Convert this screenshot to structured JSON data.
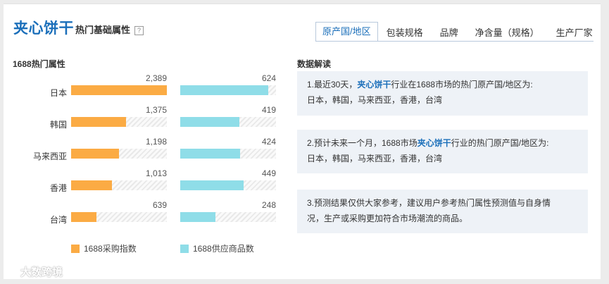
{
  "header": {
    "title_main": "夹心饼干",
    "title_sub": "热门基础属性",
    "help": "?"
  },
  "tabs": [
    {
      "label": "原产国/地区",
      "active": true
    },
    {
      "label": "包装规格",
      "active": false
    },
    {
      "label": "品牌",
      "active": false
    },
    {
      "label": "净含量（规格）",
      "active": false
    },
    {
      "label": "生产厂家",
      "active": false
    }
  ],
  "left": {
    "title": "1688热门属性"
  },
  "chart_data": {
    "type": "bar",
    "categories": [
      "日本",
      "韩国",
      "马来西亚",
      "香港",
      "台湾"
    ],
    "series": [
      {
        "name": "1688采购指数",
        "values": [
          2389,
          1375,
          1198,
          1013,
          639
        ],
        "labels": [
          "2,389",
          "1,375",
          "1,198",
          "1,013",
          "639"
        ],
        "color": "#fbab44"
      },
      {
        "name": "1688供应商品数",
        "values": [
          624,
          419,
          424,
          449,
          248
        ],
        "labels": [
          "624",
          "419",
          "424",
          "449",
          "248"
        ],
        "color": "#8fdde8"
      }
    ]
  },
  "right": {
    "title": "数据解读",
    "cards": [
      {
        "prefix": "1.最近30天，",
        "keyword": "夹心饼干",
        "suffix": "行业在1688市场的热门原产国/地区为:",
        "line2": "日本，韩国，马来西亚，香港，台湾"
      },
      {
        "prefix": "2.预计未来一个月，1688市场",
        "keyword": "夹心饼干",
        "suffix": "行业的热门原产国/地区为:",
        "line2": "日本，韩国，马来西亚，香港，台湾"
      },
      {
        "prefix": "3.预测结果仅供大家参考，建议用户参考热门属性预测值与自身情",
        "keyword": "",
        "suffix": "",
        "line2": "况，生产或采购更加符合市场潮流的商品。"
      }
    ]
  },
  "watermark": {
    "text": "大数跨境"
  }
}
